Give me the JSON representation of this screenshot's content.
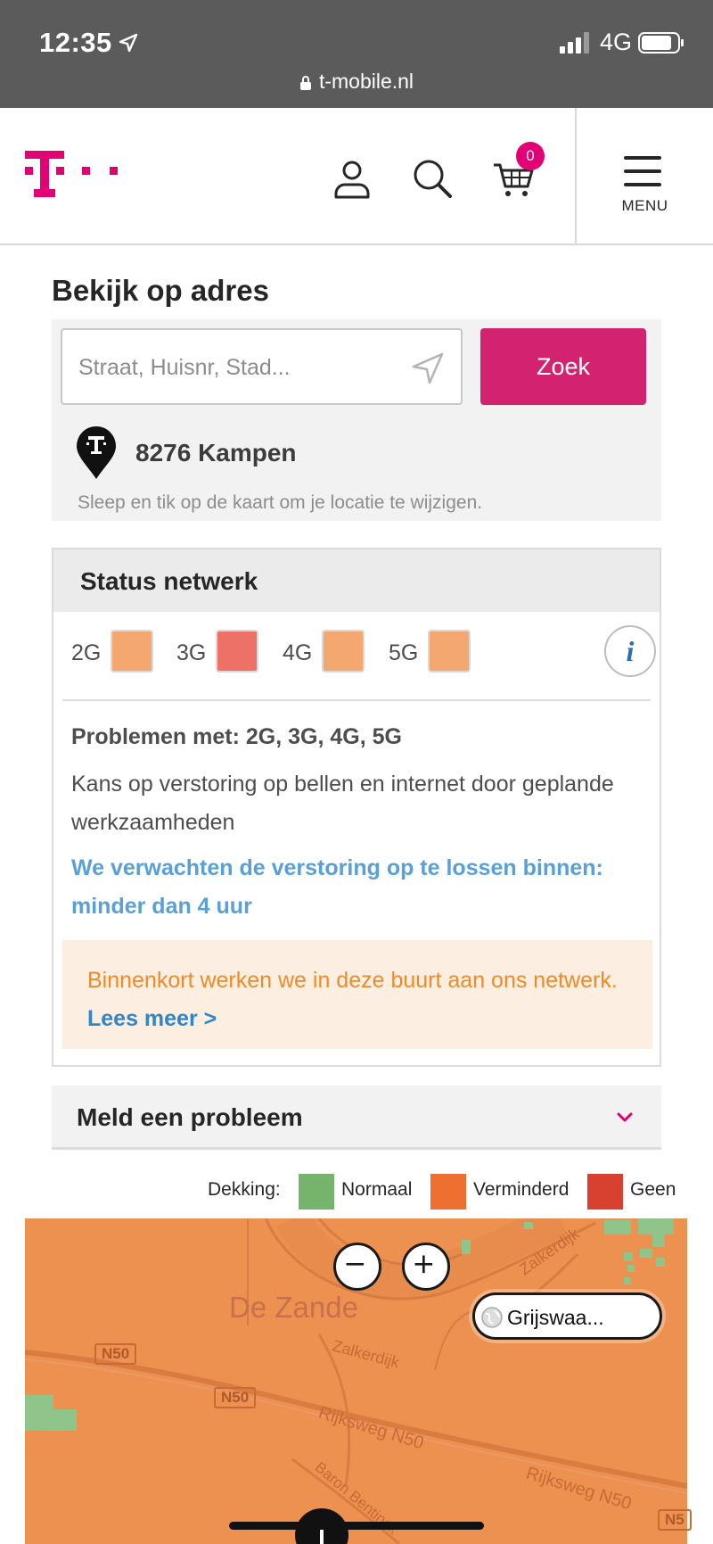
{
  "status_bar": {
    "time": "12:35",
    "network": "4G",
    "url": "t-mobile.nl"
  },
  "header": {
    "cart_count": "0",
    "menu_label": "MENU"
  },
  "address": {
    "title": "Bekijk op adres",
    "placeholder": "Straat, Huisnr, Stad...",
    "search_button": "Zoek",
    "location": "8276 Kampen",
    "hint": "Sleep en tik op de kaart om je locatie te wijzigen."
  },
  "status_network": {
    "title": "Status netwerk",
    "generations": [
      {
        "label": "2G",
        "color": "#f4a76e"
      },
      {
        "label": "3G",
        "color": "#ee7168"
      },
      {
        "label": "4G",
        "color": "#f4a76e"
      },
      {
        "label": "5G",
        "color": "#f4a76e"
      }
    ],
    "info_icon": "i",
    "problems_title": "Problemen met: 2G, 3G, 4G, 5G",
    "problems_desc": "Kans op verstoring op bellen en internet door geplande werkzaamheden",
    "eta": "We verwachten de verstoring op te lossen binnen: minder dan 4 uur",
    "notice_text": "Binnenkort werken we in deze buurt aan ons netwerk.",
    "notice_link": "Lees meer >"
  },
  "report": {
    "title": "Meld een probleem"
  },
  "legend": {
    "label": "Dekking:",
    "items": [
      {
        "label": "Normaal",
        "color": "#76b46e"
      },
      {
        "label": "Verminderd",
        "color": "#ee7030"
      },
      {
        "label": "Geen",
        "color": "#d8402f"
      }
    ]
  },
  "map": {
    "grayscale_button": "Grijswaa...",
    "place_label": "De Zande",
    "road_labels": [
      "Zalkerdijk",
      "Zalkerdijk",
      "Rijksweg N50",
      "Rijksweg N50",
      "Baron Bentinck"
    ],
    "road_shields": [
      "N50",
      "N50",
      "N5"
    ],
    "colors": {
      "coverage_reduced": "#ec9150",
      "coverage_normal": "#8fc48a"
    }
  },
  "colors": {
    "brand": "#e20074",
    "button": "#d3226f",
    "link": "#2f86c8"
  }
}
